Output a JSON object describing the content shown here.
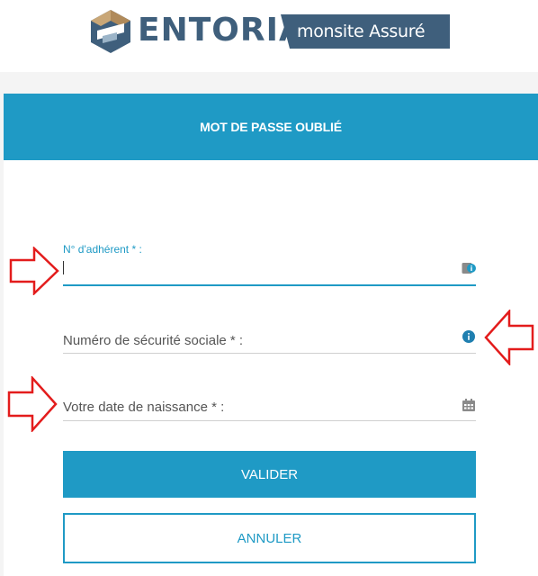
{
  "brand": {
    "name": "ENTORIA",
    "tagline": "monsite Assuré",
    "colors": {
      "navy": "#3f5f7c",
      "gold": "#b08a5a",
      "accent": "#1f9ac5",
      "annotation": "#e31c1c"
    }
  },
  "card": {
    "title": "MOT DE PASSE OUBLIÉ"
  },
  "form": {
    "member_number": {
      "label": "N° d'adhérent * :",
      "value": "",
      "icon": "card-icon"
    },
    "social_security": {
      "placeholder": "Numéro de sécurité sociale * :",
      "icon": "info-icon"
    },
    "birth_date": {
      "placeholder": "Votre date de naissance * :",
      "icon": "calendar-icon"
    },
    "submit_label": "VALIDER",
    "cancel_label": "ANNULER"
  },
  "annotations": [
    "arrow-right",
    "arrow-left",
    "arrow-right"
  ]
}
